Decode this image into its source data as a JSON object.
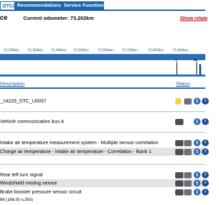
{
  "tabs": [
    {
      "label": "DTCs",
      "active": true
    },
    {
      "label": "Recommendations",
      "active": false
    },
    {
      "label": "Service Functions",
      "active": false
    }
  ],
  "header": {
    "title": "ce",
    "odometer_label": "Current odometer: 73,202km",
    "show_link": "Show relate"
  },
  "timeline": {
    "ticks": [
      "72,200km",
      "72,300km",
      "72,400km",
      "72,500km",
      "72,600km",
      "72,700km",
      "72,800km",
      "72,900km"
    ],
    "events": [
      "1",
      "45"
    ]
  },
  "table": {
    "description_header": "Description",
    "status_header": "Status",
    "groups": [
      {
        "rows": [
          "_14229_DTC_U0037"
        ]
      },
      {
        "rows": [
          "Vehicle communication bus A"
        ]
      },
      {
        "rows": [
          "Intake air temperature measurement system - Multiple sensor correlation",
          "Charge air temperature - Intake air temperature - Correlation - Bank 1"
        ]
      },
      {
        "rows": [
          "Rear left turn signal",
          "Windshield misting sensor",
          "Brake booster pressure sensor circuit"
        ]
      }
    ]
  },
  "footer": "66 (168.00 v,350)",
  "colors": {
    "accent": "#1c63a8",
    "link_red": "#cc0000"
  }
}
